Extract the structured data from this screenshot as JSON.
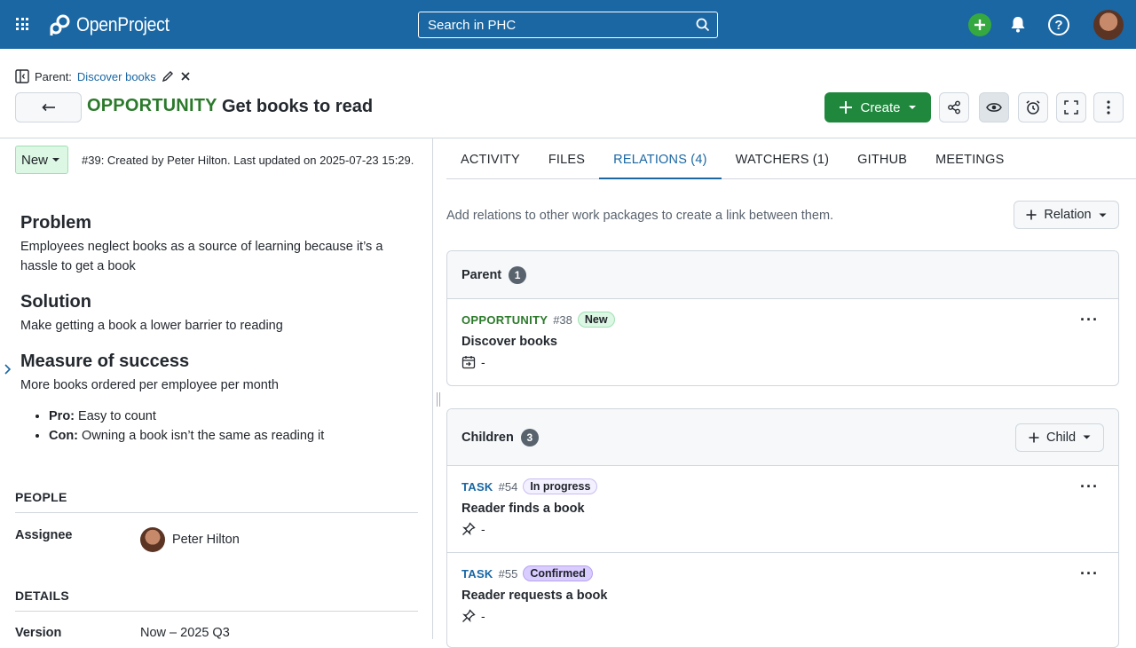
{
  "topbar": {
    "logo_text": "OpenProject",
    "search_placeholder": "Search in PHC",
    "icons": [
      "grid-icon",
      "search-icon",
      "plus-icon",
      "bell-icon",
      "help-icon",
      "user-avatar"
    ]
  },
  "header": {
    "parent_label": "Parent:",
    "parent_link": "Discover books",
    "type": "OPPORTUNITY",
    "subject": "Get books to read",
    "create_label": "Create"
  },
  "left": {
    "status": "New",
    "created_info": "#39: Created by Peter Hilton. Last updated on 2025-07-23 15:29.",
    "description": {
      "problem_title": "Problem",
      "problem_text": "Employees neglect books as a source of learning because it’s a hassle to get a book",
      "solution_title": "Solution",
      "solution_text": "Make getting a book a lower barrier to reading",
      "measure_title": "Measure of success",
      "measure_text": "More books ordered per employee per month",
      "pro_label": "Pro:",
      "pro_text": "Easy to count",
      "con_label": "Con:",
      "con_text": "Owning a book isn’t the same as reading it"
    },
    "people_title": "PEOPLE",
    "assignee_label": "Assignee",
    "assignee_value": "Peter Hilton",
    "details_title": "DETAILS",
    "version_label": "Version",
    "version_value": "Now – 2025 Q3"
  },
  "right": {
    "tabs": [
      "ACTIVITY",
      "FILES",
      "RELATIONS (4)",
      "WATCHERS (1)",
      "GITHUB",
      "MEETINGS"
    ],
    "active_tab": "RELATIONS (4)",
    "hint": "Add relations to other work packages to create a link between them.",
    "relation_btn": "Relation",
    "parent_box": {
      "title": "Parent",
      "count": "1",
      "items": [
        {
          "type": "OPPORTUNITY",
          "id": "#38",
          "status": "New",
          "subject": "Discover books",
          "date": "-"
        }
      ]
    },
    "children_box": {
      "title": "Children",
      "count": "3",
      "child_btn": "Child",
      "items": [
        {
          "type": "TASK",
          "id": "#54",
          "status": "In progress",
          "subject": "Reader finds a book",
          "date": "-"
        },
        {
          "type": "TASK",
          "id": "#55",
          "status": "Confirmed",
          "subject": "Reader requests a book",
          "date": "-"
        }
      ]
    }
  },
  "colors": {
    "topbar": "#1a67a3",
    "opportunity": "#2b7a2b",
    "task": "#1a67a3",
    "create_button": "#1f883d"
  }
}
